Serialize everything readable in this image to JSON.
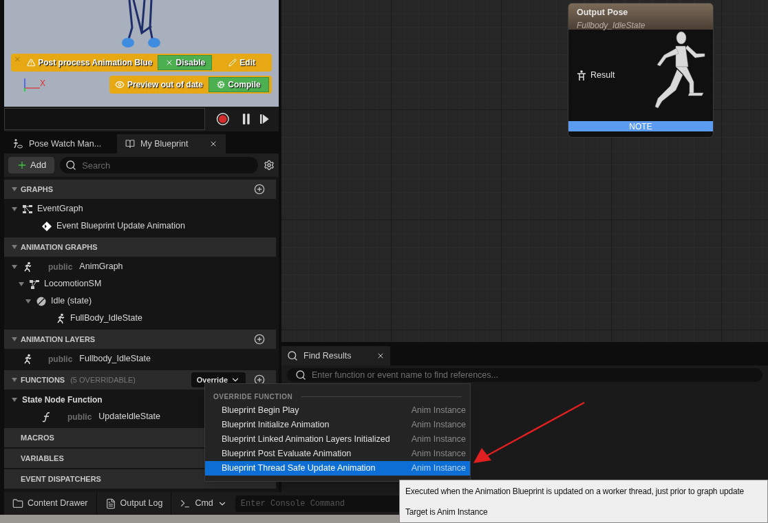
{
  "viewport": {
    "notifications": [
      {
        "kind": "warning",
        "closable": true,
        "text": "Post process Animation Blue",
        "button": "Disable",
        "link": "Edit"
      },
      {
        "kind": "preview",
        "closable": false,
        "text": "Preview out of date",
        "button": "Compile"
      }
    ],
    "axis_label": "X"
  },
  "playback": {
    "recording": true
  },
  "tabs": [
    {
      "label": "Pose Watch Man...",
      "selected": false,
      "kind": "pose"
    },
    {
      "label": "My Blueprint",
      "selected": true,
      "kind": "book"
    }
  ],
  "toolbar": {
    "add_label": "Add",
    "search": {
      "placeholder": "Search"
    }
  },
  "sections": [
    {
      "title": "GRAPHS",
      "expanded": true,
      "add_button": true,
      "items": [
        {
          "label": "EventGraph",
          "kind": "graph",
          "expanded": true,
          "children": [
            {
              "label": "Event Blueprint Update Animation",
              "kind": "event"
            }
          ]
        }
      ]
    },
    {
      "title": "ANIMATION GRAPHS",
      "expanded": true,
      "add_button": false,
      "items": [
        {
          "label": "AnimGraph",
          "access": "public",
          "kind": "anim",
          "expanded": true,
          "children": [
            {
              "label": "LocomotionSM",
              "kind": "statemachine",
              "expanded": true,
              "children": [
                {
                  "label": "Idle (state)",
                  "kind": "state",
                  "expanded": true,
                  "children": [
                    {
                      "label": "FullBody_IdleState",
                      "kind": "anim"
                    }
                  ]
                }
              ]
            }
          ]
        }
      ]
    },
    {
      "title": "ANIMATION LAYERS",
      "expanded": true,
      "add_button": true,
      "items": [
        {
          "label": "Fullbody_IdleState",
          "access": "public",
          "kind": "anim"
        }
      ]
    },
    {
      "title": "FUNCTIONS",
      "subtitle": "(5 OVERRIDABLE)",
      "override": "Override",
      "expanded": true,
      "add_button": true,
      "items": [
        {
          "label": "State Node Function",
          "kind": "category",
          "expanded": true,
          "children": [
            {
              "label": "UpdateIdleState",
              "access": "public",
              "kind": "function"
            }
          ]
        }
      ]
    },
    {
      "title": "MACROS",
      "expanded": false
    },
    {
      "title": "VARIABLES",
      "expanded": false
    },
    {
      "title": "EVENT DISPATCHERS",
      "expanded": false,
      "add_button": false
    }
  ],
  "graph_node": {
    "title": "Output Pose",
    "subtitle": "Fullbody_IdleState",
    "pin": "Result",
    "footer": "NOTE"
  },
  "find_results": {
    "tab": "Find Results",
    "placeholder": "Enter function or event name to find references..."
  },
  "override_menu": {
    "header": "OVERRIDE FUNCTION",
    "items": [
      {
        "name": "Blueprint Begin Play",
        "target": "Anim Instance",
        "selected": false
      },
      {
        "name": "Blueprint Initialize Animation",
        "target": "Anim Instance",
        "selected": false
      },
      {
        "name": "Blueprint Linked Animation Layers Initialized",
        "target": "Anim Instance",
        "selected": false
      },
      {
        "name": "Blueprint Post Evaluate Animation",
        "target": "Anim Instance",
        "selected": false
      },
      {
        "name": "Blueprint Thread Safe Update Animation",
        "target": "Anim Instance",
        "selected": true
      }
    ]
  },
  "tooltip": {
    "lines": [
      "Executed when the Animation Blueprint is updated on a worker thread, just prior to graph update",
      "Target is Anim Instance"
    ]
  },
  "status_bar": {
    "items": [
      {
        "label": "Content Drawer",
        "kind": "folder"
      },
      {
        "label": "Output Log",
        "kind": "log"
      }
    ],
    "cmd": "Cmd",
    "console_placeholder": "Enter Console Command"
  }
}
